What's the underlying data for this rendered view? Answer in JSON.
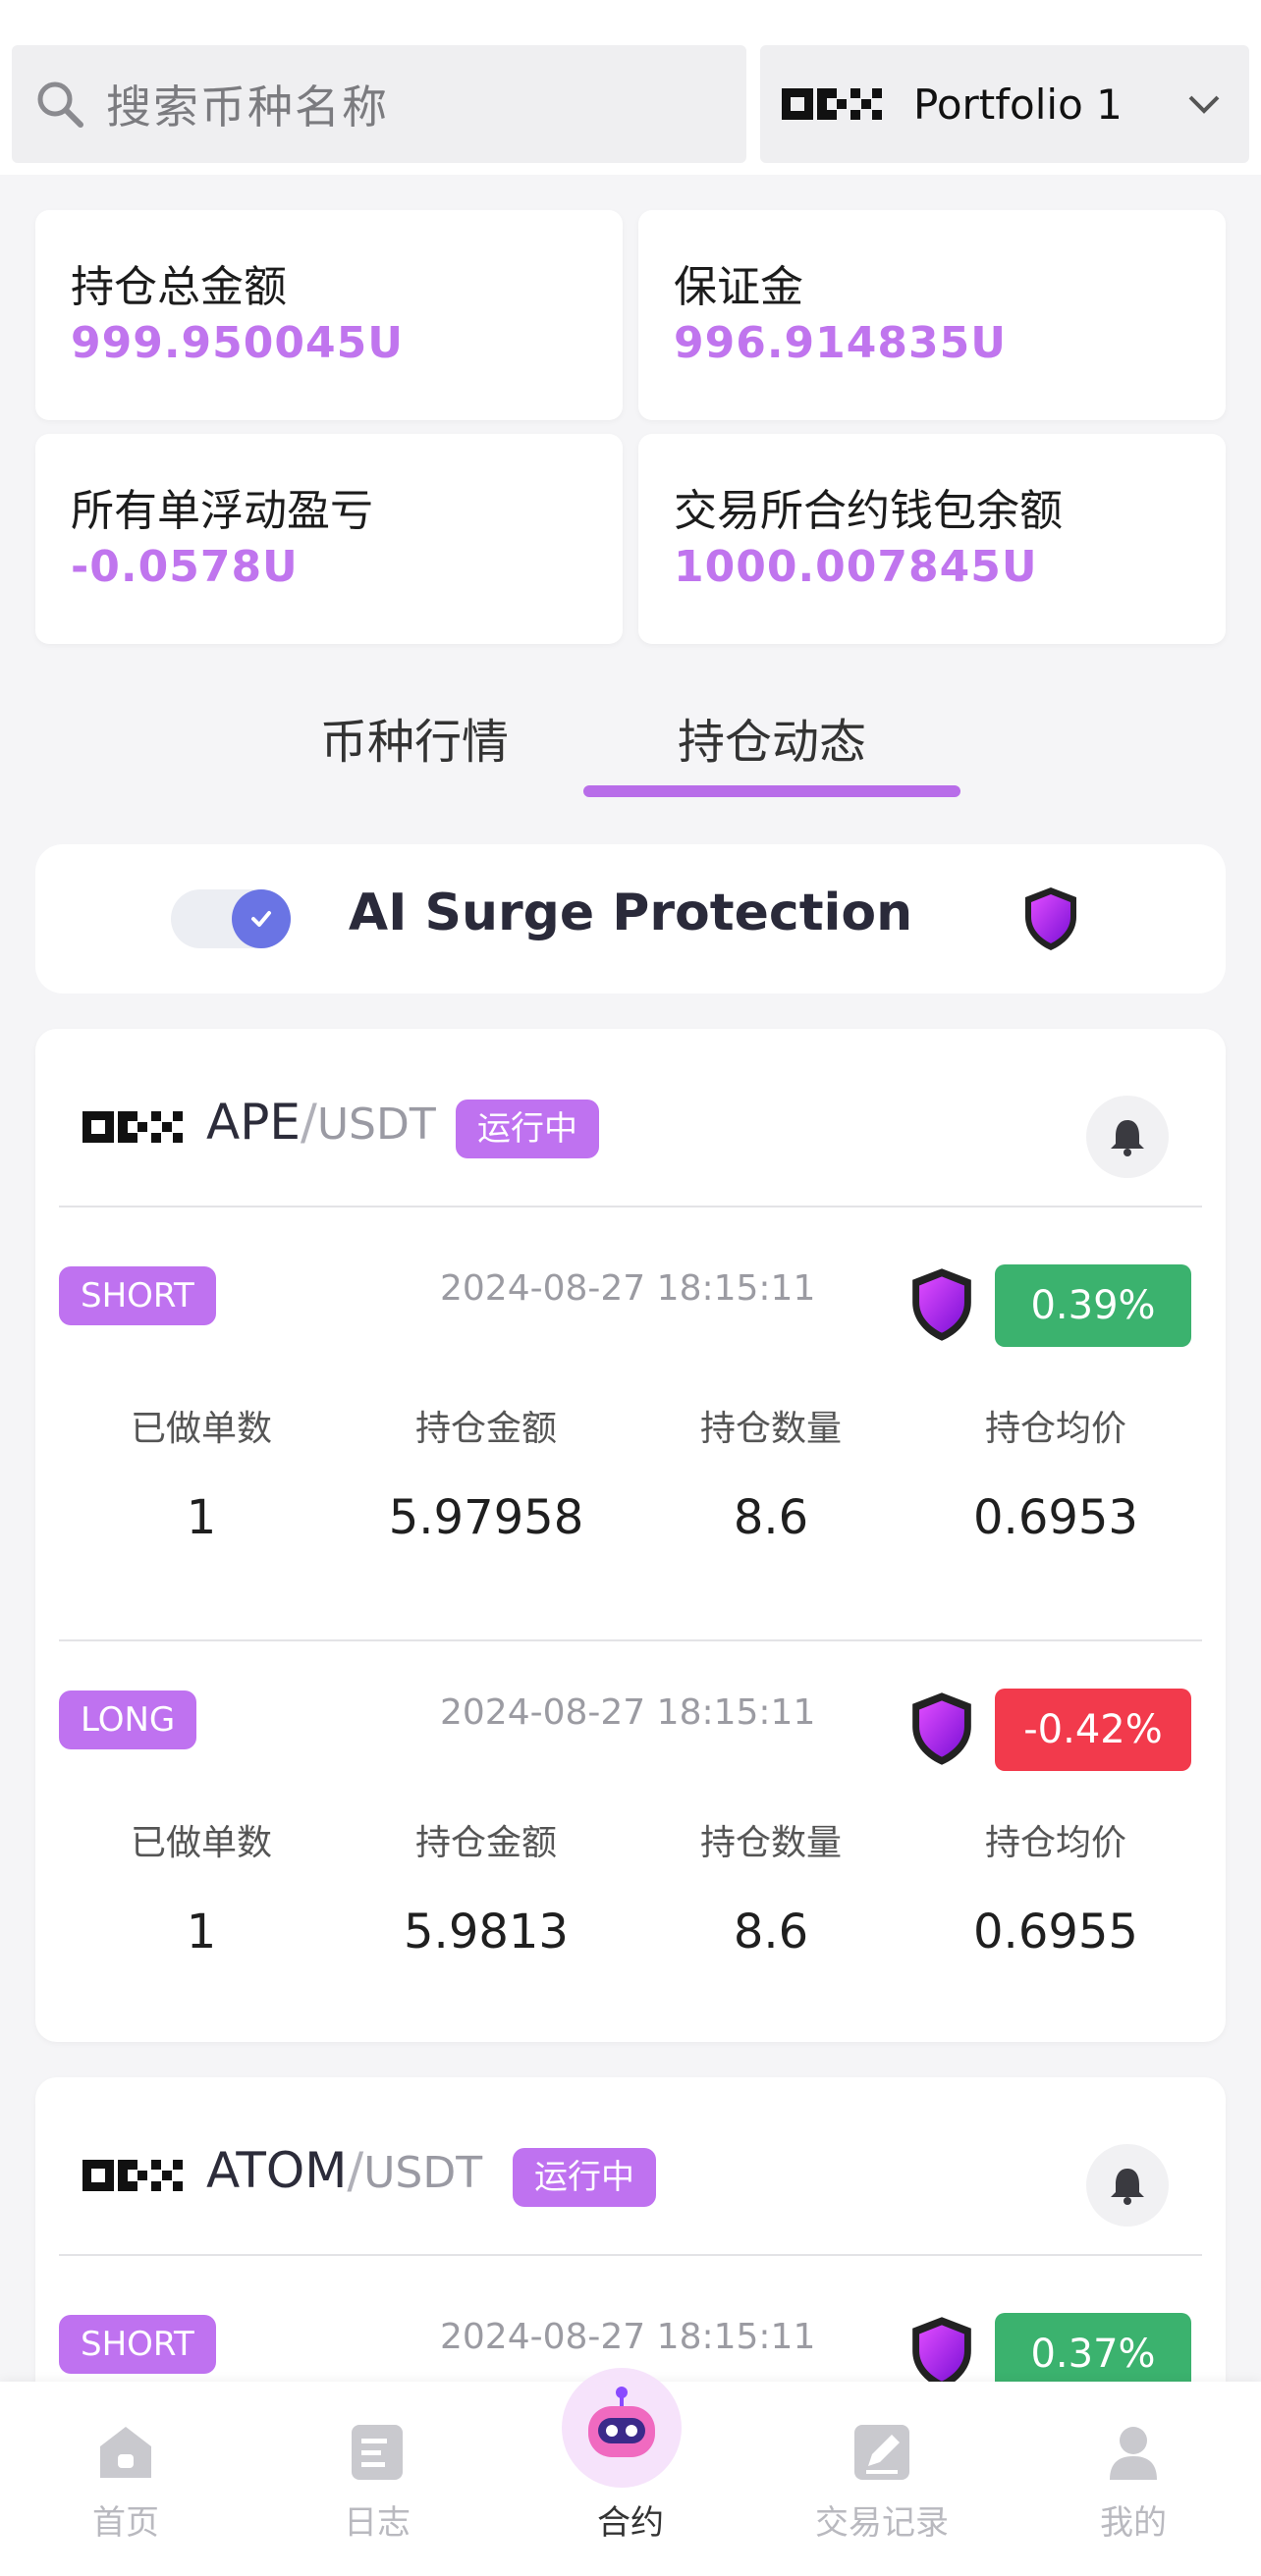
{
  "search": {
    "placeholder": "搜索币种名称"
  },
  "portfolio": {
    "label": "Portfolio 1"
  },
  "stats": [
    {
      "title": "持仓总金额",
      "value": "999.950045U"
    },
    {
      "title": "保证金",
      "value": "996.914835U"
    },
    {
      "title": "所有单浮动盈亏",
      "value": "-0.0578U"
    },
    {
      "title": "交易所合约钱包余额",
      "value": "1000.007845U"
    }
  ],
  "tabs": [
    {
      "label": "币种行情"
    },
    {
      "label": "持仓动态",
      "active": true
    }
  ],
  "surge": {
    "title": "AI Surge Protection",
    "enabled": true
  },
  "columns": [
    "已做单数",
    "持仓金额",
    "持仓数量",
    "持仓均价"
  ],
  "cards": [
    {
      "base": "APE",
      "slash": "/",
      "quote": "USDT",
      "status": "运行中",
      "positions": [
        {
          "side": "SHORT",
          "time": "2024-08-27 18:15:11",
          "pct": "0.39%",
          "dir": "up",
          "values": [
            "1",
            "5.97958",
            "8.6",
            "0.6953"
          ]
        },
        {
          "side": "LONG",
          "time": "2024-08-27 18:15:11",
          "pct": "-0.42%",
          "dir": "down",
          "values": [
            "1",
            "5.9813",
            "8.6",
            "0.6955"
          ]
        }
      ]
    },
    {
      "base": "ATOM",
      "slash": "/",
      "quote": "USDT",
      "status": "运行中",
      "positions": [
        {
          "side": "SHORT",
          "time": "2024-08-27 18:15:11",
          "pct": "0.37%",
          "dir": "up"
        }
      ]
    }
  ],
  "nav": [
    {
      "label": "首页",
      "icon": "home-icon"
    },
    {
      "label": "日志",
      "icon": "log-icon"
    },
    {
      "label": "合约",
      "icon": "robot-icon",
      "active": true
    },
    {
      "label": "交易记录",
      "icon": "edit-record-icon"
    },
    {
      "label": "我的",
      "icon": "user-icon"
    }
  ],
  "colors": {
    "accent": "#bf72f0",
    "up": "#3bb26e",
    "down": "#f23a4c",
    "value_text": "#c075ee"
  }
}
